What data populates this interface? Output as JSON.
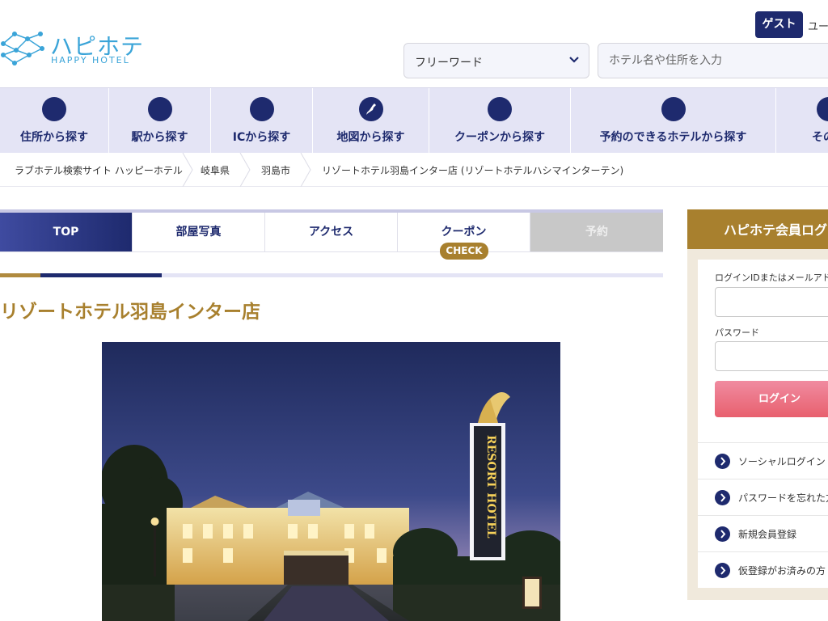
{
  "header": {
    "logo_jp": "ハピホテ",
    "logo_en": "HAPPY HOTEL",
    "guest_label": "ゲスト",
    "user_label": "ユー",
    "search_type": "フリーワード",
    "search_placeholder": "ホテル名や住所を入力"
  },
  "nav": {
    "items": [
      {
        "label": "住所から探す",
        "icon": "circle-icon"
      },
      {
        "label": "駅から探す",
        "icon": "circle-icon"
      },
      {
        "label": "ICから探す",
        "icon": "circle-icon"
      },
      {
        "label": "地図から探す",
        "icon": "japan-map-icon"
      },
      {
        "label": "クーポンから探す",
        "icon": "circle-icon"
      },
      {
        "label": "予約のできるホテルから探す",
        "icon": "circle-icon"
      },
      {
        "label": "その他",
        "icon": "circle-icon"
      }
    ]
  },
  "breadcrumb": {
    "items": [
      "ラブホテル検索サイト ハッピーホテル",
      "岐阜県",
      "羽島市",
      "リゾートホテル羽島インター店 (リゾートホテルハシマインターテン)"
    ]
  },
  "tabs": {
    "items": [
      "TOP",
      "部屋写真",
      "アクセス",
      "クーポン",
      "予約"
    ],
    "check_badge": "CHECK"
  },
  "hotel": {
    "title": "リゾートホテル羽島インター店",
    "sign_text": "RESORT HOTEL"
  },
  "login": {
    "header": "ハピホテ会員ログイン",
    "id_label": "ログインIDまたはメールアドレス",
    "password_label": "パスワード",
    "login_button": "ログイン",
    "links": [
      "ソーシャルログイン",
      "パスワードを忘れた方",
      "新規会員登録",
      "仮登録がお済みの方"
    ]
  },
  "colors": {
    "navy": "#1e2a6e",
    "gold": "#a8802e",
    "nav_bg": "#e4e4f5",
    "login_pink": "#e8606e"
  }
}
